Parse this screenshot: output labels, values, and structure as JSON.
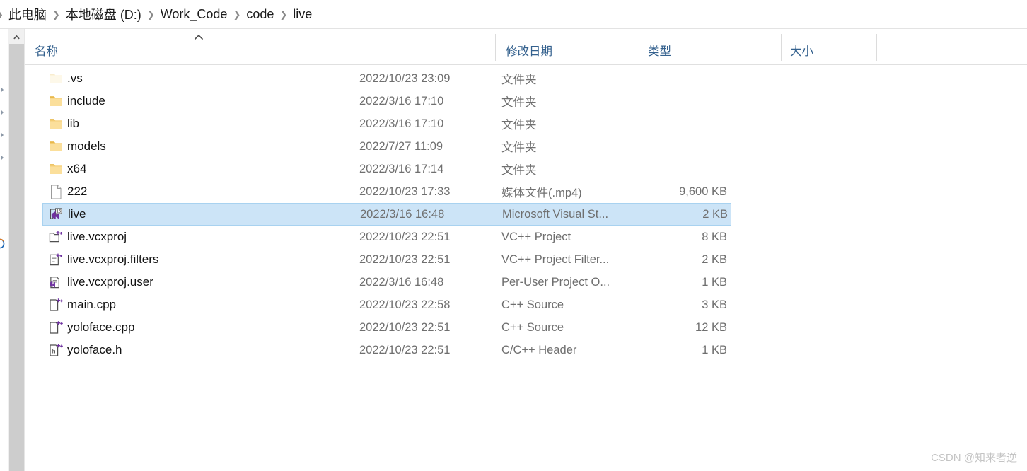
{
  "breadcrumb": {
    "separator": "❯",
    "items": [
      {
        "label": "此电脑"
      },
      {
        "label": "本地磁盘 (D:)"
      },
      {
        "label": "Work_Code"
      },
      {
        "label": "code"
      },
      {
        "label": "live"
      }
    ]
  },
  "columns": {
    "name": "名称",
    "date_modified": "修改日期",
    "type": "类型",
    "size": "大小",
    "sort_column": "名称",
    "sort_direction": "ascending"
  },
  "files": [
    {
      "name": ".vs",
      "date": "2022/10/23 23:09",
      "type": "文件夹",
      "size": "",
      "icon": "folder-hidden-icon",
      "selected": false
    },
    {
      "name": "include",
      "date": "2022/3/16 17:10",
      "type": "文件夹",
      "size": "",
      "icon": "folder-icon",
      "selected": false
    },
    {
      "name": "lib",
      "date": "2022/3/16 17:10",
      "type": "文件夹",
      "size": "",
      "icon": "folder-icon",
      "selected": false
    },
    {
      "name": "models",
      "date": "2022/7/27 11:09",
      "type": "文件夹",
      "size": "",
      "icon": "folder-icon",
      "selected": false
    },
    {
      "name": "x64",
      "date": "2022/3/16 17:14",
      "type": "文件夹",
      "size": "",
      "icon": "folder-icon",
      "selected": false
    },
    {
      "name": "222",
      "date": "2022/10/23 17:33",
      "type": "媒体文件(.mp4)",
      "size": "9,600 KB",
      "icon": "blank-file-icon",
      "selected": false
    },
    {
      "name": "live",
      "date": "2022/3/16 16:48",
      "type": "Microsoft Visual St...",
      "size": "2 KB",
      "icon": "vs-solution-icon",
      "selected": true
    },
    {
      "name": "live.vcxproj",
      "date": "2022/10/23 22:51",
      "type": "VC++ Project",
      "size": "8 KB",
      "icon": "vcxproj-icon",
      "selected": false
    },
    {
      "name": "live.vcxproj.filters",
      "date": "2022/10/23 22:51",
      "type": "VC++ Project Filter...",
      "size": "2 KB",
      "icon": "vcxproj-filters-icon",
      "selected": false
    },
    {
      "name": "live.vcxproj.user",
      "date": "2022/3/16 16:48",
      "type": "Per-User Project O...",
      "size": "1 KB",
      "icon": "vcxproj-user-icon",
      "selected": false
    },
    {
      "name": "main.cpp",
      "date": "2022/10/23 22:58",
      "type": "C++ Source",
      "size": "3 KB",
      "icon": "cpp-source-icon",
      "selected": false
    },
    {
      "name": "yoloface.cpp",
      "date": "2022/10/23 22:51",
      "type": "C++ Source",
      "size": "12 KB",
      "icon": "cpp-source-icon",
      "selected": false
    },
    {
      "name": "yoloface.h",
      "date": "2022/10/23 22:51",
      "type": "C/C++ Header",
      "size": "1 KB",
      "icon": "c-header-icon",
      "selected": false
    }
  ],
  "scrollbar": {
    "up_arrow": "▲",
    "orientation": "vertical"
  },
  "nav_pane": {
    "chevrons": 4,
    "cloud_item_icon": "onedrive-icon"
  },
  "watermark": "CSDN @知来者逆",
  "colors": {
    "selection_fill": "#cce4f7",
    "selection_border": "#a8d2f0",
    "header_text": "#34618e",
    "secondary_text": "#6f6f6f",
    "folder_yellow": "#f7d27f",
    "vs_purple": "#6f32a0",
    "scrollbar_track": "#cdcdcd"
  }
}
